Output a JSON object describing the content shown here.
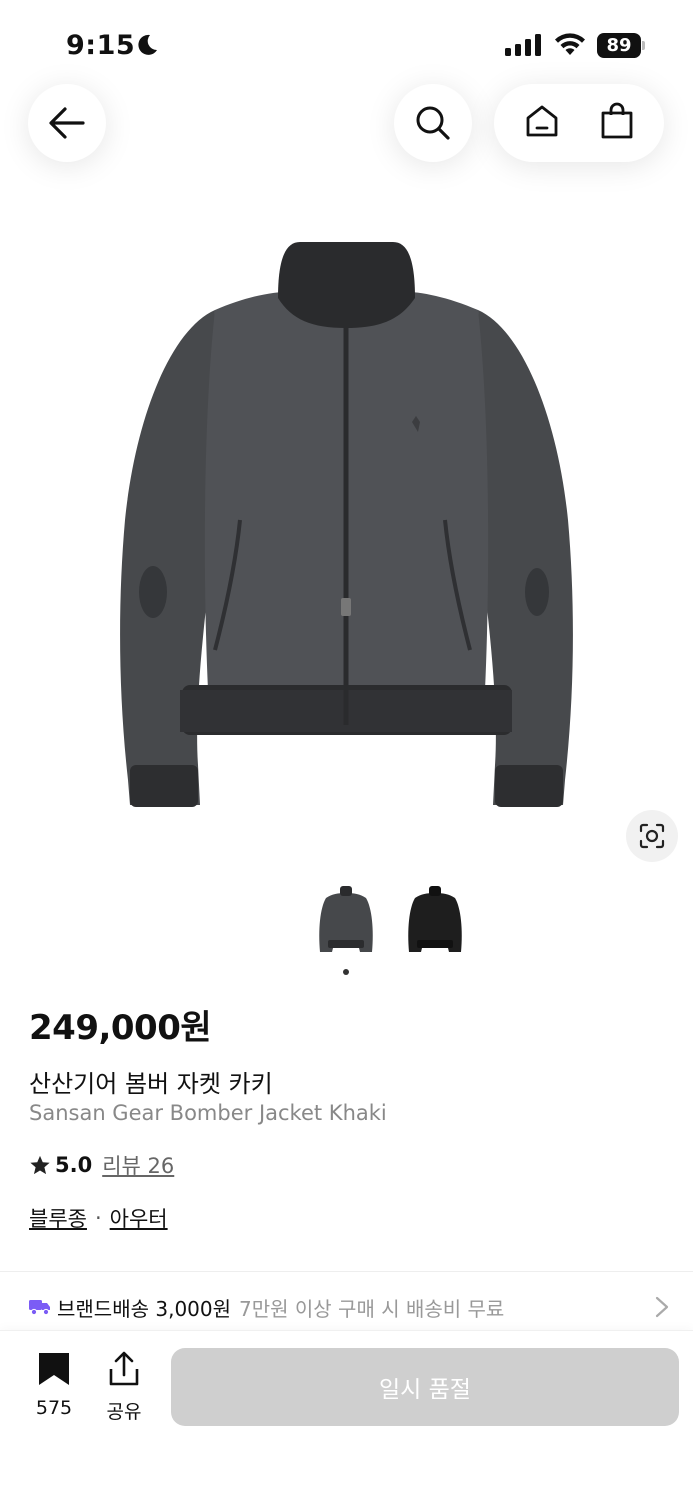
{
  "status_bar": {
    "time": "9:15",
    "battery": "89"
  },
  "nav": {
    "back_icon": "arrow-left-icon",
    "search_icon": "search-icon",
    "home_icon": "home-icon",
    "bag_icon": "shopping-bag-icon"
  },
  "product": {
    "price": "249,000원",
    "name_ko": "산산기어 봄버 자켓 카키",
    "name_en": "Sansan Gear Bomber Jacket Khaki",
    "rating": "5.0",
    "review_label": "리뷰 26",
    "categories": [
      "블루종",
      "아우터"
    ],
    "category_separator": "·"
  },
  "shipping": {
    "label": "브랜드배송 3,000원",
    "note": "7만원 이상 구매 시 배송비 무료"
  },
  "bottom_bar": {
    "bookmark_count": "575",
    "share_label": "공유",
    "soldout_label": "일시 품절"
  },
  "colors": {
    "button_disabled": "#cfcfcf",
    "truck_icon": "#7b5cf5",
    "jacket_gray": "#46484b",
    "jacket_black": "#1e1e1e"
  }
}
